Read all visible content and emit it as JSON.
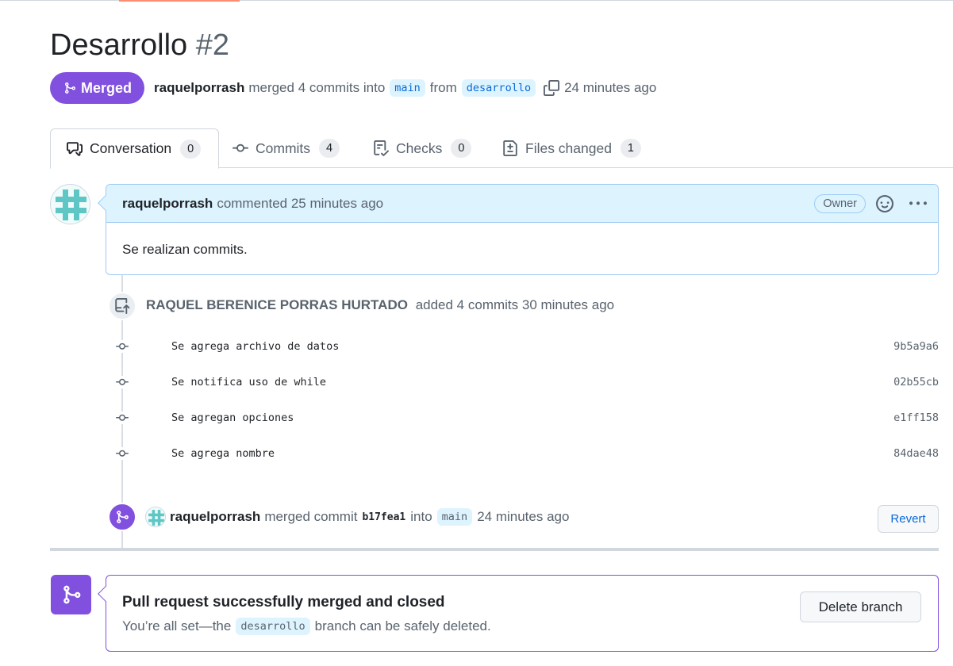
{
  "pr": {
    "title": "Desarrollo",
    "number": "#2",
    "state": "Merged",
    "author": "raquelporrash",
    "merged_text": "merged 4 commits into",
    "base_branch": "main",
    "from_text": "from",
    "head_branch": "desarrollo",
    "time": "24 minutes ago"
  },
  "tabs": [
    {
      "label": "Conversation",
      "count": "0",
      "icon": "comment-discussion-icon"
    },
    {
      "label": "Commits",
      "count": "4",
      "icon": "git-commit-icon"
    },
    {
      "label": "Checks",
      "count": "0",
      "icon": "checklist-icon"
    },
    {
      "label": "Files changed",
      "count": "1",
      "icon": "file-diff-icon"
    }
  ],
  "comment": {
    "author": "raquelporrash",
    "action": "commented 25 minutes ago",
    "badge": "Owner",
    "body": "Se realizan commits."
  },
  "commits_event": {
    "author": "RAQUEL BERENICE PORRAS HURTADO",
    "text": "added 4 commits 30 minutes ago",
    "commits": [
      {
        "message": "Se agrega archivo de datos",
        "sha": "9b5a9a6"
      },
      {
        "message": "Se notifica uso de while",
        "sha": "02b55cb"
      },
      {
        "message": "Se agregan opciones",
        "sha": "e1ff158"
      },
      {
        "message": "Se agrega nombre",
        "sha": "84dae48"
      }
    ]
  },
  "merge_event": {
    "author": "raquelporrash",
    "text": "merged commit",
    "sha": "b17fea1",
    "into_text": "into",
    "branch": "main",
    "time": "24 minutes ago",
    "revert_label": "Revert"
  },
  "merged_box": {
    "title": "Pull request successfully merged and closed",
    "sub_before": "You’re all set—the",
    "branch": "desarrollo",
    "sub_after": "branch can be safely deleted.",
    "delete_label": "Delete branch"
  },
  "colors": {
    "merged_purple": "#8250df",
    "link_blue": "#0969da",
    "comment_header": "#ddf4ff"
  }
}
